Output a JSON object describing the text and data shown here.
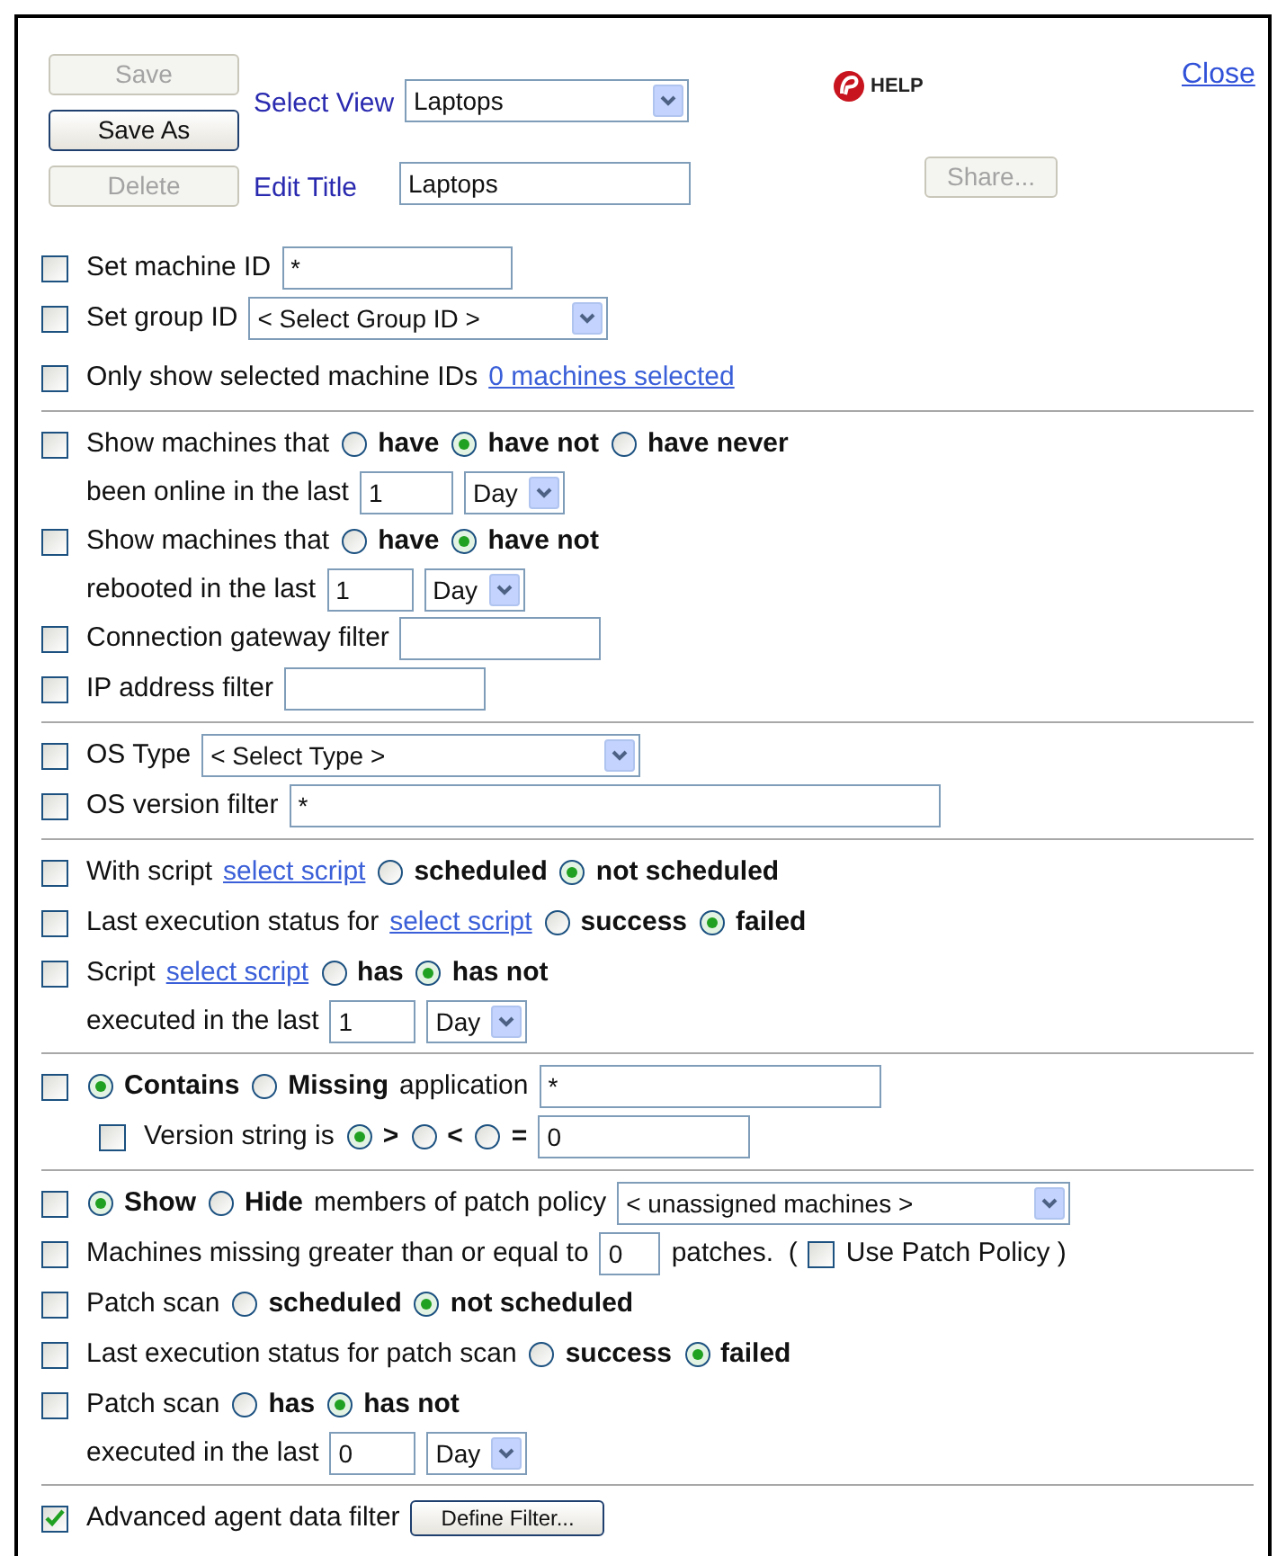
{
  "header": {
    "buttons": [
      {
        "label": "Save",
        "disabled": true
      },
      {
        "label": "Save As",
        "disabled": false
      },
      {
        "label": "Delete",
        "disabled": true
      }
    ],
    "select_view": {
      "label": "Select View",
      "value": "Laptops"
    },
    "edit_title": {
      "label": "Edit Title",
      "value": "Laptops"
    },
    "help": "HELP",
    "close": "Close",
    "share": {
      "label": "Share...",
      "disabled": true
    }
  },
  "sections": [
    {
      "rows": [
        {
          "kind": "filter",
          "parts": [
            {
              "kind": "checkbox",
              "checked": false
            },
            {
              "kind": "text",
              "text": "Set machine ID"
            },
            {
              "kind": "input",
              "value": "*"
            }
          ]
        },
        {
          "kind": "filter",
          "parts": [
            {
              "kind": "checkbox",
              "checked": false
            },
            {
              "kind": "text",
              "text": "Set group ID"
            },
            {
              "kind": "select",
              "value": "< Select Group ID >"
            }
          ]
        },
        {
          "kind": "filter",
          "parts": [
            {
              "kind": "checkbox",
              "checked": false
            },
            {
              "kind": "text",
              "text": "Only show selected machine IDs"
            },
            {
              "kind": "link",
              "text": "0 machines selected"
            }
          ]
        }
      ]
    },
    {
      "rows": [
        {
          "kind": "filter",
          "parts": [
            {
              "kind": "checkbox",
              "checked": false
            },
            {
              "kind": "text",
              "text": "Show machines that"
            },
            {
              "kind": "radio",
              "selected": false,
              "label": "have"
            },
            {
              "kind": "radio",
              "selected": true,
              "label": "have not"
            },
            {
              "kind": "radio",
              "selected": false,
              "label": "have never"
            }
          ]
        },
        {
          "kind": "continued",
          "parts": [
            {
              "kind": "text",
              "text": "been online in the last"
            },
            {
              "kind": "input",
              "value": "1"
            },
            {
              "kind": "select",
              "value": "Day"
            }
          ]
        },
        {
          "kind": "filter",
          "parts": [
            {
              "kind": "checkbox",
              "checked": false
            },
            {
              "kind": "text",
              "text": "Show machines that"
            },
            {
              "kind": "radio",
              "selected": false,
              "label": "have"
            },
            {
              "kind": "radio",
              "selected": true,
              "label": "have not"
            }
          ]
        },
        {
          "kind": "continued",
          "parts": [
            {
              "kind": "text",
              "text": "rebooted in the last"
            },
            {
              "kind": "input",
              "value": "1"
            },
            {
              "kind": "select",
              "value": "Day"
            }
          ]
        },
        {
          "kind": "filter",
          "parts": [
            {
              "kind": "checkbox",
              "checked": false
            },
            {
              "kind": "text",
              "text": "Connection gateway filter"
            },
            {
              "kind": "input"
            }
          ]
        },
        {
          "kind": "filter",
          "parts": [
            {
              "kind": "checkbox",
              "checked": false
            },
            {
              "kind": "text",
              "text": "IP address filter"
            },
            {
              "kind": "input"
            }
          ]
        }
      ]
    },
    {
      "rows": [
        {
          "kind": "filter",
          "parts": [
            {
              "kind": "checkbox",
              "checked": false
            },
            {
              "kind": "text",
              "text": "OS Type"
            },
            {
              "kind": "select",
              "value": "< Select Type >"
            }
          ]
        },
        {
          "kind": "filter",
          "parts": [
            {
              "kind": "checkbox",
              "checked": false
            },
            {
              "kind": "text",
              "text": "OS version filter"
            },
            {
              "kind": "input",
              "value": "*"
            }
          ]
        }
      ]
    },
    {
      "rows": [
        {
          "kind": "filter",
          "parts": [
            {
              "kind": "checkbox",
              "checked": false
            },
            {
              "kind": "text",
              "text": "With script"
            },
            {
              "kind": "link",
              "text": "select script"
            },
            {
              "kind": "radio",
              "selected": false,
              "label": "scheduled"
            },
            {
              "kind": "radio",
              "selected": true,
              "label": "not scheduled"
            }
          ]
        },
        {
          "kind": "filter",
          "parts": [
            {
              "kind": "checkbox",
              "checked": false
            },
            {
              "kind": "text",
              "text": "Last execution status for"
            },
            {
              "kind": "link",
              "text": "select script"
            },
            {
              "kind": "radio",
              "selected": false,
              "label": "success"
            },
            {
              "kind": "radio",
              "selected": true,
              "label": "failed"
            }
          ]
        },
        {
          "kind": "filter",
          "parts": [
            {
              "kind": "checkbox",
              "checked": false
            },
            {
              "kind": "text",
              "text": "Script"
            },
            {
              "kind": "link",
              "text": "select script"
            },
            {
              "kind": "radio",
              "selected": false,
              "label": "has"
            },
            {
              "kind": "radio",
              "selected": true,
              "label": "has not"
            }
          ]
        },
        {
          "kind": "continued",
          "parts": [
            {
              "kind": "text",
              "text": "executed in the last"
            },
            {
              "kind": "input",
              "value": "1"
            },
            {
              "kind": "select",
              "value": "Day"
            }
          ]
        }
      ]
    },
    {
      "rows": [
        {
          "kind": "filter",
          "parts": [
            {
              "kind": "checkbox",
              "checked": false
            },
            {
              "kind": "radio",
              "selected": true,
              "label": "Contains"
            },
            {
              "kind": "radio",
              "selected": false,
              "label": "Missing"
            },
            {
              "kind": "text",
              "text": "application"
            },
            {
              "kind": "input",
              "value": "*"
            }
          ]
        },
        {
          "kind": "sub",
          "parts": [
            {
              "kind": "checkbox",
              "checked": false
            },
            {
              "kind": "text",
              "text": "Version string is"
            },
            {
              "kind": "radio",
              "selected": true,
              "label": ">"
            },
            {
              "kind": "radio",
              "selected": false,
              "label": "<"
            },
            {
              "kind": "radio",
              "selected": false,
              "label": "="
            },
            {
              "kind": "input",
              "value": "0"
            }
          ]
        }
      ]
    },
    {
      "rows": [
        {
          "kind": "filter",
          "parts": [
            {
              "kind": "checkbox",
              "checked": false
            },
            {
              "kind": "radio",
              "selected": true,
              "label": "Show"
            },
            {
              "kind": "radio",
              "selected": false,
              "label": "Hide"
            },
            {
              "kind": "text",
              "text": "members of patch policy"
            },
            {
              "kind": "select",
              "value": "< unassigned machines >"
            }
          ]
        },
        {
          "kind": "filter",
          "parts": [
            {
              "kind": "checkbox",
              "checked": false
            },
            {
              "kind": "text",
              "text": "Machines missing greater than or equal to"
            },
            {
              "kind": "input",
              "value": "0"
            },
            {
              "kind": "text",
              "text": "patches.  ("
            },
            {
              "kind": "checkbox",
              "checked": false
            },
            {
              "kind": "text",
              "text": "Use Patch Policy )"
            }
          ]
        },
        {
          "kind": "filter",
          "parts": [
            {
              "kind": "checkbox",
              "checked": false
            },
            {
              "kind": "text",
              "text": "Patch scan"
            },
            {
              "kind": "radio",
              "selected": false,
              "label": "scheduled"
            },
            {
              "kind": "radio",
              "selected": true,
              "label": "not scheduled"
            }
          ]
        },
        {
          "kind": "filter",
          "parts": [
            {
              "kind": "checkbox",
              "checked": false
            },
            {
              "kind": "text",
              "text": "Last execution status for patch scan"
            },
            {
              "kind": "radio",
              "selected": false,
              "label": "success"
            },
            {
              "kind": "radio",
              "selected": true,
              "label": "failed"
            }
          ]
        },
        {
          "kind": "filter",
          "parts": [
            {
              "kind": "checkbox",
              "checked": false
            },
            {
              "kind": "text",
              "text": "Patch scan"
            },
            {
              "kind": "radio",
              "selected": false,
              "label": "has"
            },
            {
              "kind": "radio",
              "selected": true,
              "label": "has not"
            }
          ]
        },
        {
          "kind": "continued",
          "parts": [
            {
              "kind": "text",
              "text": "executed in the last"
            },
            {
              "kind": "input",
              "value": "0"
            },
            {
              "kind": "select",
              "value": "Day"
            }
          ]
        }
      ]
    },
    {
      "rows": [
        {
          "kind": "filter",
          "parts": [
            {
              "kind": "checkbox",
              "checked": true
            },
            {
              "kind": "text",
              "text": "Advanced agent data filter"
            },
            {
              "kind": "button",
              "label": "Define Filter..."
            }
          ]
        }
      ]
    }
  ]
}
